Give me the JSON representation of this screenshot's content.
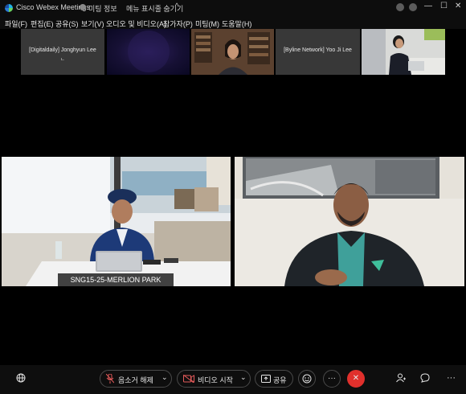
{
  "window": {
    "app_title": "Cisco Webex Meetings",
    "meeting_info": "미팅 정보",
    "hide_menu": "메뉴 표시줄 숨기기",
    "chevron": "^",
    "minimize": "—",
    "maximize": "☐",
    "close": "✕"
  },
  "menu": [
    "파일(F)",
    "편집(E)",
    "공유(S)",
    "보기(V)",
    "오디오 및 비디오(A)",
    "참가자(P)",
    "미팅(M)",
    "도움말(H)"
  ],
  "thumbnails": [
    {
      "label": "[Digitaldaily] Jonghyun Lee",
      "mic": "ㄴ"
    },
    {
      "label": "",
      "mic": ""
    },
    {
      "label": "",
      "mic": ""
    },
    {
      "label": "[Byline Network] Yoo Ji Lee",
      "mic": ""
    },
    {
      "label": "",
      "mic": ""
    }
  ],
  "main_tiles": [
    {
      "name": "SNG15-25-MERLION PARK"
    },
    {
      "name": ""
    }
  ],
  "toolbar": {
    "mute_label": "음소거 해제",
    "video_label": "비디오 시작",
    "share_label": "공유",
    "more_label": "···",
    "end_label": "✕",
    "dropdown": "⌄"
  },
  "colors": {
    "background": "#000000",
    "chrome": "#0d0d0d",
    "end_button": "#e0302c",
    "muted_red": "#e35a5a",
    "thumb_tile": "#383838"
  },
  "icons": {
    "logo": "webex-logo-icon",
    "mic_muted": "mic-off-icon",
    "video_off": "video-off-icon",
    "share": "share-icon",
    "reactions": "smiley-icon",
    "participants": "participants-icon",
    "chat": "chat-icon",
    "more": "more-icon",
    "apps": "globe-icon"
  }
}
